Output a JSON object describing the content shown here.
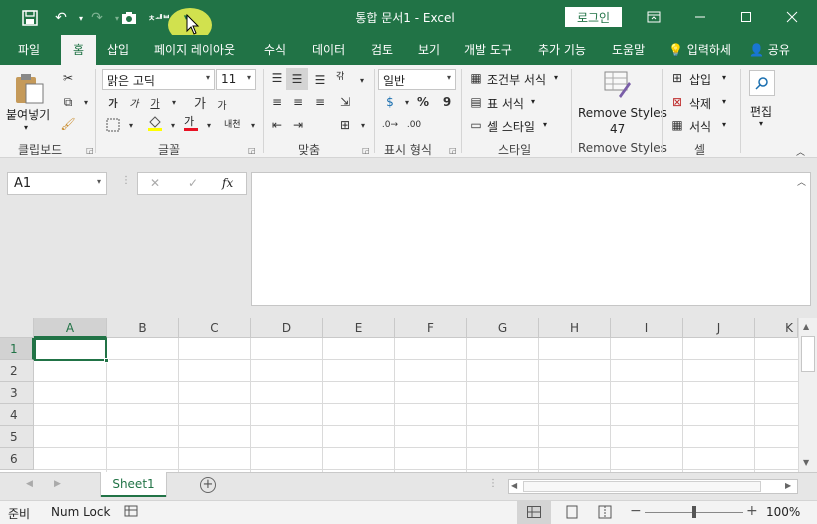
{
  "titlebar": {
    "doc_title": "통합 문서1  -  Excel",
    "login_label": "로그인",
    "qat_sub_label": "ㅊᅫᄇ"
  },
  "tabs": [
    "파일",
    "홈",
    "삽입",
    "페이지 레이아웃",
    "수식",
    "데이터",
    "검토",
    "보기",
    "개발 도구",
    "추가 기능",
    "도움말"
  ],
  "tell_me": "입력하세",
  "share": "공유",
  "ribbon": {
    "clipboard": {
      "paste_label": "붙여넣기",
      "group": "클립보드"
    },
    "font": {
      "name": "맑은 고딕",
      "size": "11",
      "group": "글꼴",
      "bold": "가",
      "italic": "가",
      "underline": "가",
      "grow": "가",
      "shrink": "가",
      "phonetic": "내천",
      "font_color_glyph": "가"
    },
    "alignment": {
      "group": "맞춤",
      "wrap_glyph": "갂"
    },
    "number": {
      "format": "일반",
      "group": "표시 형식",
      "percent": "%",
      "comma": "9"
    },
    "styles": {
      "conditional": "조건부 서식",
      "table": "표 서식",
      "cell": "셀 스타일",
      "group": "스타일"
    },
    "remove_styles": {
      "label": "Remove Styles",
      "count": "47",
      "group": "Remove Styles"
    },
    "cells": {
      "insert": "삽입",
      "delete": "삭제",
      "format": "서식",
      "group": "셀"
    },
    "editing": {
      "label": "편집"
    }
  },
  "formula_bar": {
    "namebox": "A1",
    "fx": "fx",
    "cancel": "✕",
    "enter": "✓"
  },
  "grid": {
    "columns": [
      "A",
      "B",
      "C",
      "D",
      "E",
      "F",
      "G",
      "H",
      "I",
      "J",
      "K"
    ],
    "rows": [
      "1",
      "2",
      "3",
      "4",
      "5",
      "6"
    ]
  },
  "sheet": {
    "name": "Sheet1"
  },
  "statusbar": {
    "ready": "준비",
    "num_lock": "Num Lock",
    "zoom": "100%"
  }
}
